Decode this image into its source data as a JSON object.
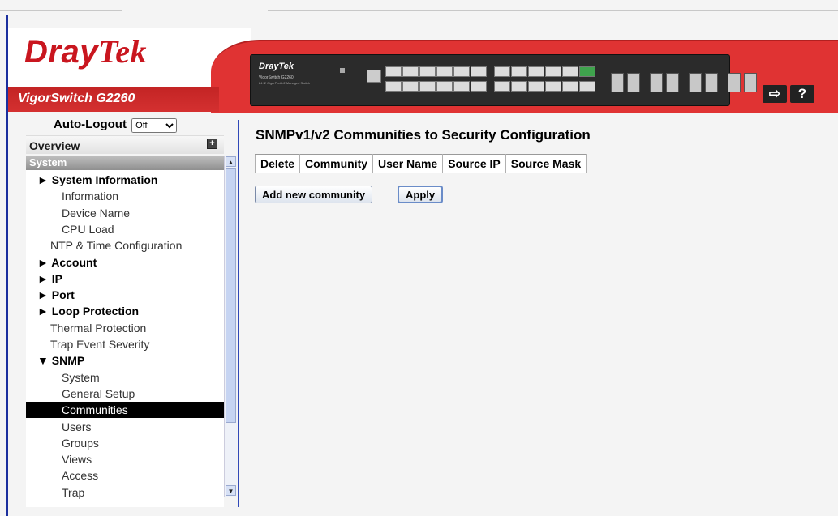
{
  "header": {
    "brand_dray": "Dray",
    "brand_tek": "Tek",
    "model": "VigorSwitch G2260",
    "device_brand": "DrayTek",
    "device_model": "VigorSwitch G2260",
    "device_desc": "24+2 Giga Port L2 Managed Switch",
    "logout_icon": "logout-icon",
    "help_icon": "help-icon"
  },
  "sidebar": {
    "autologout_label": "Auto-Logout",
    "autologout_value": "Off",
    "overview": "Overview",
    "section": "System",
    "items": [
      {
        "label": "► System Information",
        "bold": true
      },
      {
        "label": "Information"
      },
      {
        "label": "Device Name"
      },
      {
        "label": "CPU Load"
      },
      {
        "label": "NTP & Time Configuration"
      },
      {
        "label": "► Account",
        "bold": true
      },
      {
        "label": "► IP",
        "bold": true
      },
      {
        "label": "► Port",
        "bold": true
      },
      {
        "label": "► Loop Protection",
        "bold": true
      },
      {
        "label": "Thermal Protection"
      },
      {
        "label": "Trap Event Severity"
      },
      {
        "label": "▼ SNMP",
        "bold": true
      },
      {
        "label": "System"
      },
      {
        "label": "General Setup"
      },
      {
        "label": "Communities",
        "selected": true
      },
      {
        "label": "Users"
      },
      {
        "label": "Groups"
      },
      {
        "label": "Views"
      },
      {
        "label": "Access"
      },
      {
        "label": "Trap"
      }
    ]
  },
  "main": {
    "title": "SNMPv1/v2 Communities to Security Configuration",
    "columns": [
      "Delete",
      "Community",
      "User Name",
      "Source IP",
      "Source Mask"
    ],
    "add_button": "Add new community",
    "apply_button": "Apply"
  },
  "colors": {
    "brand_red": "#e03333",
    "nav_blue": "#1b2f9e",
    "selected_bg": "#000000"
  }
}
